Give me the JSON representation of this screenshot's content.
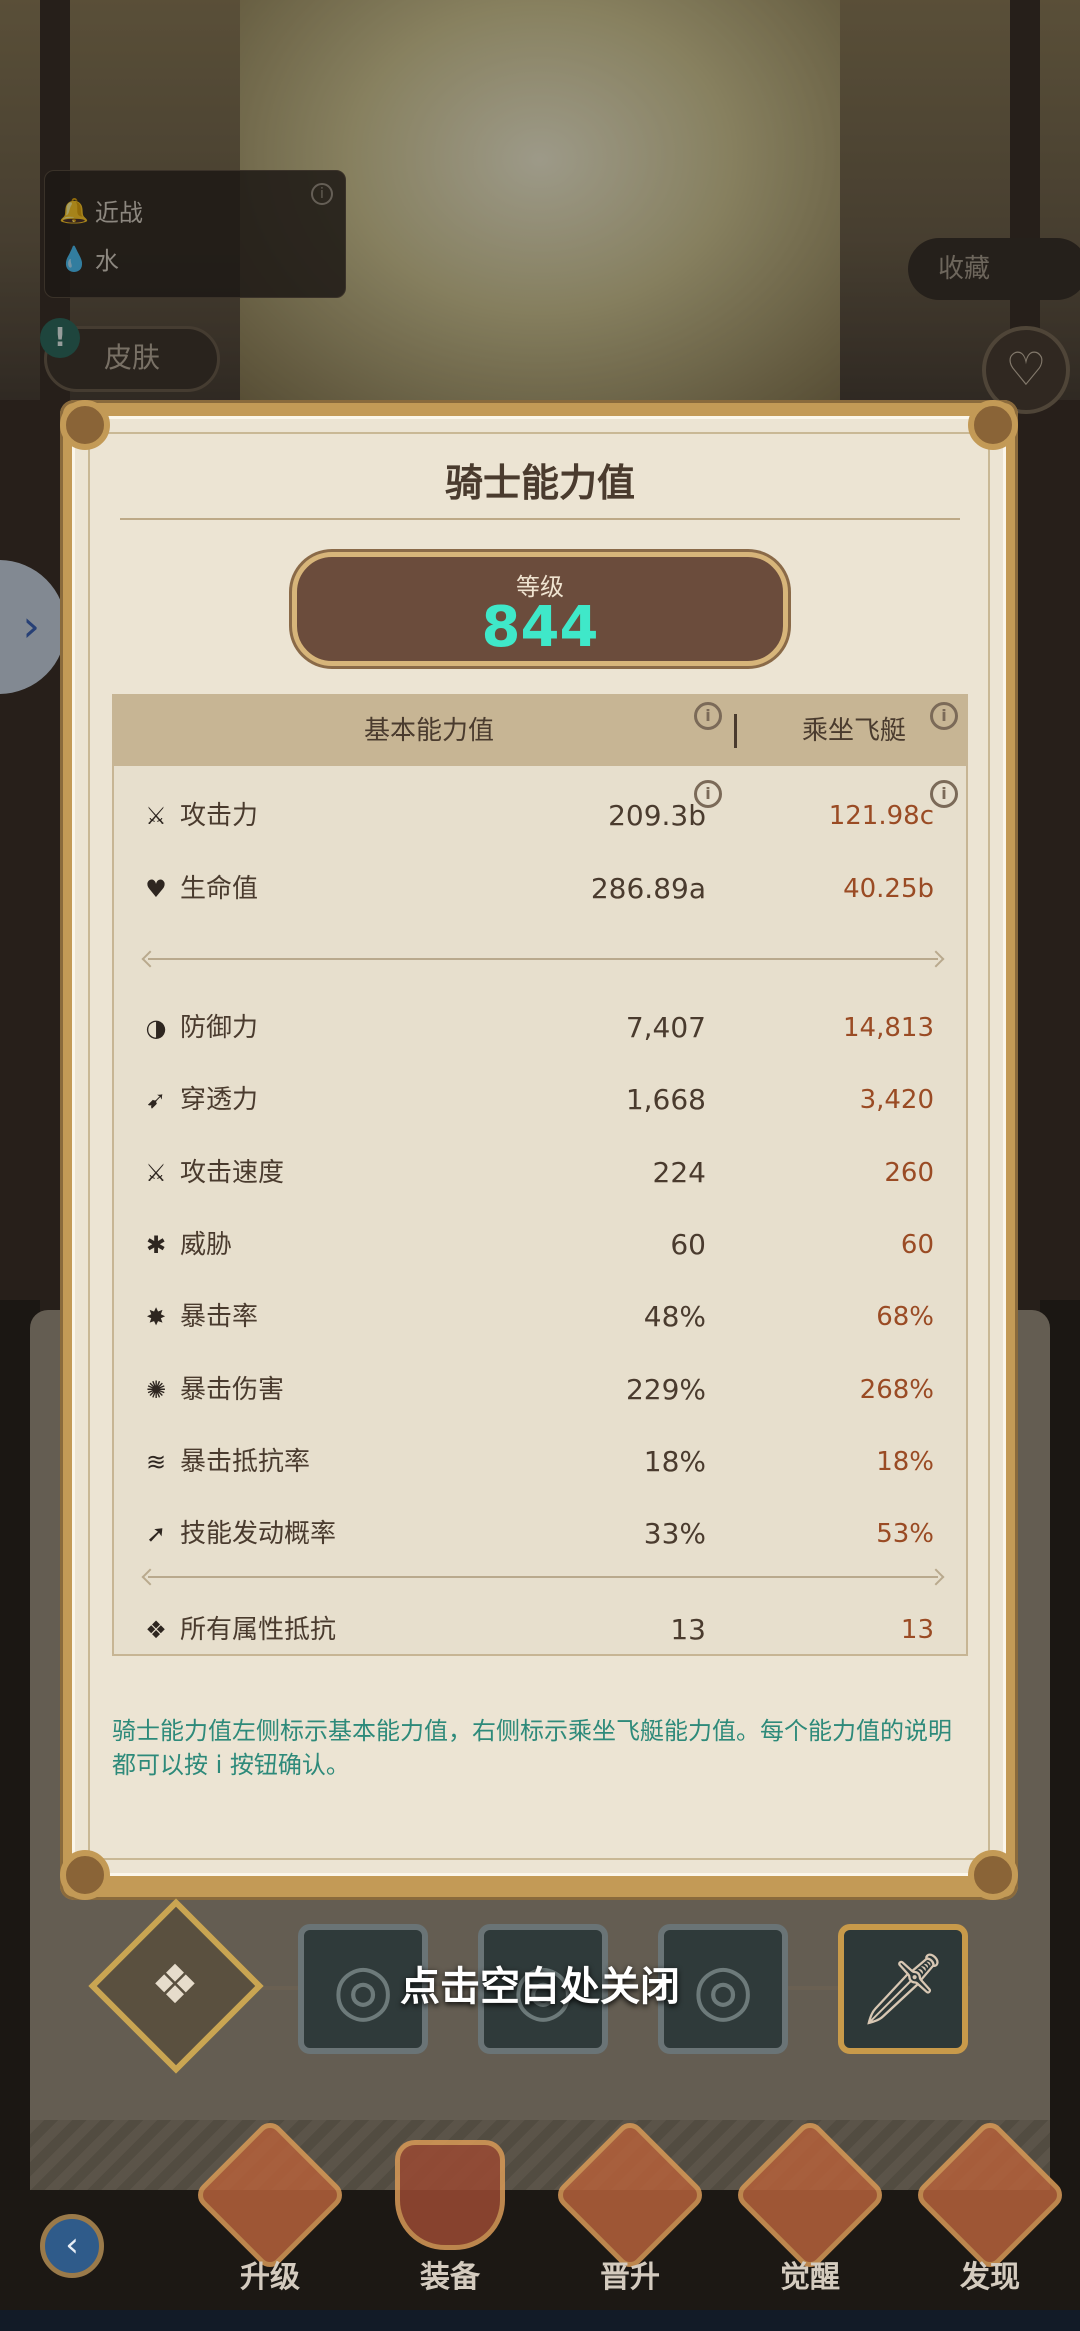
{
  "hero": {
    "attack_type": "近战",
    "element": "水",
    "skin_label": "皮肤",
    "collect_label": "收藏"
  },
  "panel": {
    "title": "骑士能力值",
    "level_label": "等级",
    "level_value": "844",
    "headers": {
      "base": "基本能力值",
      "mount": "乘坐飞艇"
    },
    "rows_group1": [
      {
        "icon": "sword-icon",
        "glyph": "⚔",
        "label": "攻击力",
        "base": "209.3b",
        "mount": "121.98c"
      },
      {
        "icon": "heart-plus-icon",
        "glyph": "♥",
        "label": "生命值",
        "base": "286.89a",
        "mount": "40.25b"
      }
    ],
    "rows_group2": [
      {
        "icon": "shield-half-icon",
        "glyph": "◑",
        "label": "防御力",
        "base": "7,407",
        "mount": "14,813"
      },
      {
        "icon": "pierce-icon",
        "glyph": "➹",
        "label": "穿透力",
        "base": "1,668",
        "mount": "3,420"
      },
      {
        "icon": "attack-speed-icon",
        "glyph": "⚔",
        "label": "攻击速度",
        "base": "224",
        "mount": "260"
      },
      {
        "icon": "threat-icon",
        "glyph": "✱",
        "label": "威胁",
        "base": "60",
        "mount": "60"
      },
      {
        "icon": "crit-rate-icon",
        "glyph": "✸",
        "label": "暴击率",
        "base": "48%",
        "mount": "68%"
      },
      {
        "icon": "crit-damage-icon",
        "glyph": "✺",
        "label": "暴击伤害",
        "base": "229%",
        "mount": "268%"
      },
      {
        "icon": "crit-resist-icon",
        "glyph": "≋",
        "label": "暴击抵抗率",
        "base": "18%",
        "mount": "18%"
      },
      {
        "icon": "skill-proc-icon",
        "glyph": "➚",
        "label": "技能发动概率",
        "base": "33%",
        "mount": "53%"
      }
    ],
    "rows_group3": [
      {
        "icon": "all-resist-icon",
        "glyph": "❖",
        "label": "所有属性抵抗",
        "base": "13",
        "mount": "13"
      }
    ],
    "description": "骑士能力值左侧标示基本能力值，右侧标示乘坐飞艇能力值。每个能力值的说明都可以按 i 按钮确认。"
  },
  "close_hint": "点击空白处关闭",
  "nav": {
    "items": [
      "升级",
      "装备",
      "晋升",
      "觉醒",
      "发现"
    ]
  },
  "colors": {
    "level_value": "#3fe8c9",
    "mount_value": "#9a4b24",
    "description": "#2e8a7a",
    "panel_gold": "#c39a56"
  }
}
